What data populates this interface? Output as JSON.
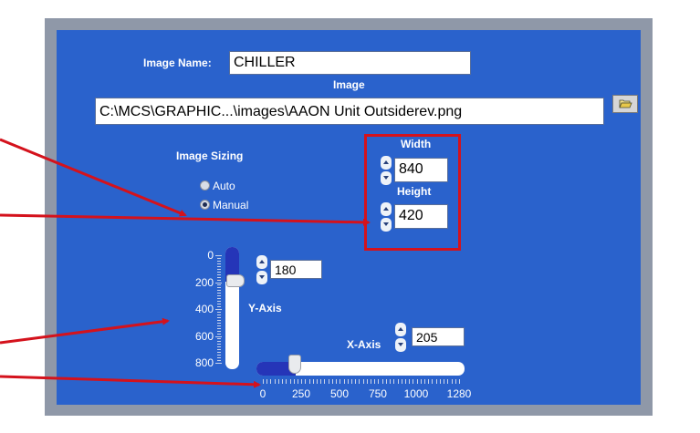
{
  "image_name": {
    "label": "Image Name:",
    "value": "CHILLER"
  },
  "image": {
    "label": "Image",
    "path": "C:\\MCS\\GRAPHIC...\\images\\AAON Unit Outsiderev.png",
    "browse_icon": "folder-open-icon"
  },
  "image_sizing": {
    "label": "Image Sizing",
    "options": [
      "Auto",
      "Manual"
    ],
    "selected": "Manual"
  },
  "size": {
    "width_label": "Width",
    "width_value": "840",
    "height_label": "Height",
    "height_value": "420"
  },
  "y_axis": {
    "label": "Y-Axis",
    "value": "180",
    "min": 0,
    "max": 800,
    "ticks": [
      "0",
      "200",
      "400",
      "600",
      "800"
    ]
  },
  "x_axis": {
    "label": "X-Axis",
    "value": "205",
    "min": 0,
    "max": 1280,
    "ticks": [
      "0",
      "250",
      "500",
      "750",
      "1000",
      "1280"
    ]
  },
  "colors": {
    "panel": "#2a62cc",
    "frame": "#8f98a8",
    "highlight": "#d4121c",
    "slider_fill": "#2535b8"
  }
}
